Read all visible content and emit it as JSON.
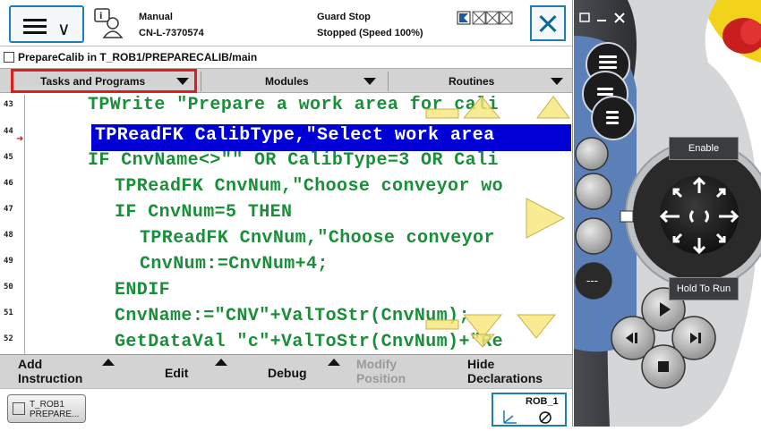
{
  "status": {
    "mode": "Manual",
    "controller": "CN-L-7370574",
    "safety": "Guard Stop",
    "run_state": "Stopped (Speed 100%)"
  },
  "path": "PrepareCalib in T_ROB1/PREPARECALIB/main",
  "tabs": [
    {
      "label": "Tasks and Programs"
    },
    {
      "label": "Modules"
    },
    {
      "label": "Routines"
    }
  ],
  "code": {
    "lines": [
      {
        "num": "43",
        "text": "TPWrite \"Prepare a work area for cali"
      },
      {
        "num": "44",
        "text": "TPReadFK CalibType,\"Select work area"
      },
      {
        "num": "45",
        "text": "IF CnvName<>\"\" OR CalibType=3 OR Cali"
      },
      {
        "num": "46",
        "text": "TPReadFK CnvNum,\"Choose conveyor wo"
      },
      {
        "num": "47",
        "text": "IF CnvNum=5 THEN"
      },
      {
        "num": "48",
        "text": "TPReadFK CnvNum,\"Choose conveyor"
      },
      {
        "num": "49",
        "text": "CnvNum:=CnvNum+4;"
      },
      {
        "num": "50",
        "text": "ENDIF"
      },
      {
        "num": "51",
        "text": "CnvName:=\"CNV\"+ValToStr(CnvNum);"
      },
      {
        "num": "52",
        "text": "GetDataVal \"c\"+ValToStr(CnvNum)+\"Re"
      }
    ]
  },
  "commands": {
    "add_instruction_1": "Add",
    "add_instruction_2": "Instruction",
    "edit": "Edit",
    "debug": "Debug",
    "modify_position_1": "Modify",
    "modify_position_2": "Position",
    "hide_declarations_1": "Hide",
    "hide_declarations_2": "Declarations"
  },
  "taskbar": {
    "task_line1": "T_ROB1",
    "task_line2": "PREPARE...",
    "robot": "ROB_1"
  },
  "pendant": {
    "enable_label": "Enable",
    "hold_to_run_label": "Hold To Run"
  },
  "colors": {
    "code_text": "#1a8f3a",
    "selection": "#0000d6",
    "highlight_border": "#e01c1c",
    "accent": "#1a7fb3"
  }
}
